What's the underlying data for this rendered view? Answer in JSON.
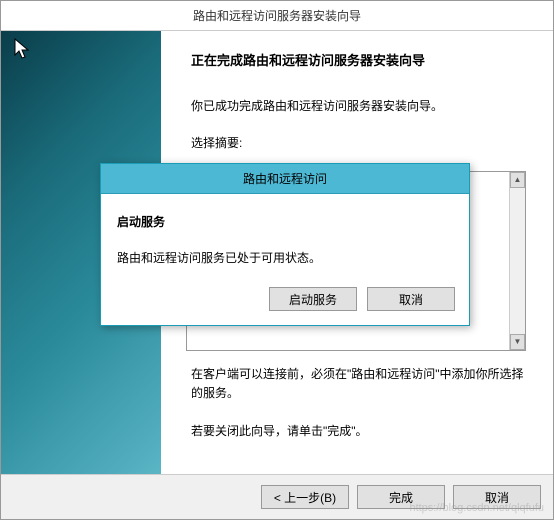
{
  "wizard": {
    "title": "路由和远程访问服务器安装向导",
    "heading": "正在完成路由和远程访问服务器安装向导",
    "success_text": "你已成功完成路由和远程访问服务器安装向导。",
    "summary_label": "选择摘要:",
    "after_text_1": "在客户端可以连接前，必须在\"路由和远程访问\"中添加你所选择的服务。",
    "after_text_2": "若要关闭此向导，请单击\"完成\"。",
    "buttons": {
      "back": "< 上一步(B)",
      "finish": "完成",
      "cancel": "取消"
    }
  },
  "modal": {
    "title": "路由和远程访问",
    "heading": "启动服务",
    "message": "路由和远程访问服务已处于可用状态。",
    "buttons": {
      "start": "启动服务",
      "cancel": "取消"
    }
  },
  "watermark": "https://blog.csdn.net/qlqfufu"
}
